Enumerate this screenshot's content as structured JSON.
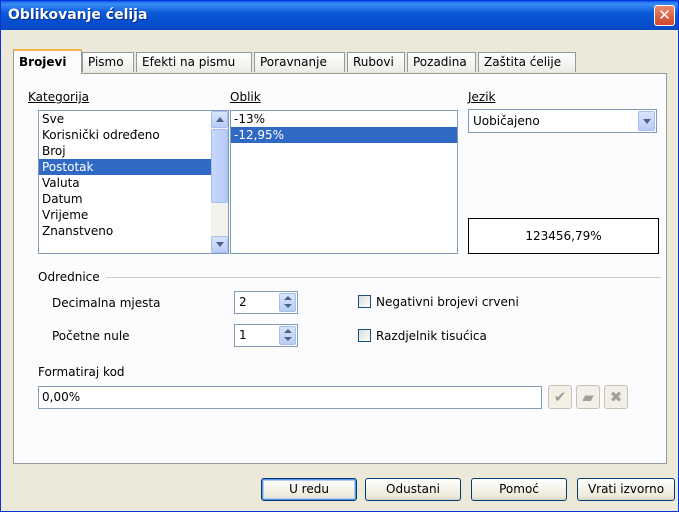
{
  "window": {
    "title": "Oblikovanje ćelija",
    "close_glyph": "✕"
  },
  "tabs": [
    {
      "label": "Brojevi",
      "active": true
    },
    {
      "label": "Pismo"
    },
    {
      "label": "Efekti na pismu"
    },
    {
      "label": "Poravnanje"
    },
    {
      "label": "Rubovi"
    },
    {
      "label": "Pozadina"
    },
    {
      "label": "Zaštita ćelije"
    }
  ],
  "category": {
    "label": "Kategorija",
    "items": [
      "Sve",
      "Korisnički određeno",
      "Broj",
      "Postotak",
      "Valuta",
      "Datum",
      "Vrijeme",
      "Znanstveno"
    ],
    "selected": "Postotak"
  },
  "format": {
    "label": "Oblik",
    "items": [
      "-13%",
      "-12,95%"
    ],
    "selected": "-12,95%"
  },
  "language": {
    "label": "Jezik",
    "value": "Uobičajeno"
  },
  "preview": {
    "value": "123456,79%"
  },
  "options": {
    "label": "Odrednice",
    "decimal_places": {
      "label": "Decimalna mjesta",
      "value": "2"
    },
    "leading_zeros": {
      "label": "Početne nule",
      "value": "1"
    },
    "negative_red": {
      "label": "Negativni brojevi crveni",
      "checked": false
    },
    "thousands_sep": {
      "label": "Razdjelnik tisućica",
      "checked": false
    }
  },
  "format_code": {
    "label": "Formatiraj kod",
    "value": "0,00%"
  },
  "icons": {
    "accept": "checkmark-icon",
    "comment": "comment-icon",
    "delete": "delete-icon"
  },
  "buttons": {
    "ok": "U redu",
    "cancel": "Odustani",
    "help": "Pomoć",
    "reset": "Vrati izvorno"
  }
}
